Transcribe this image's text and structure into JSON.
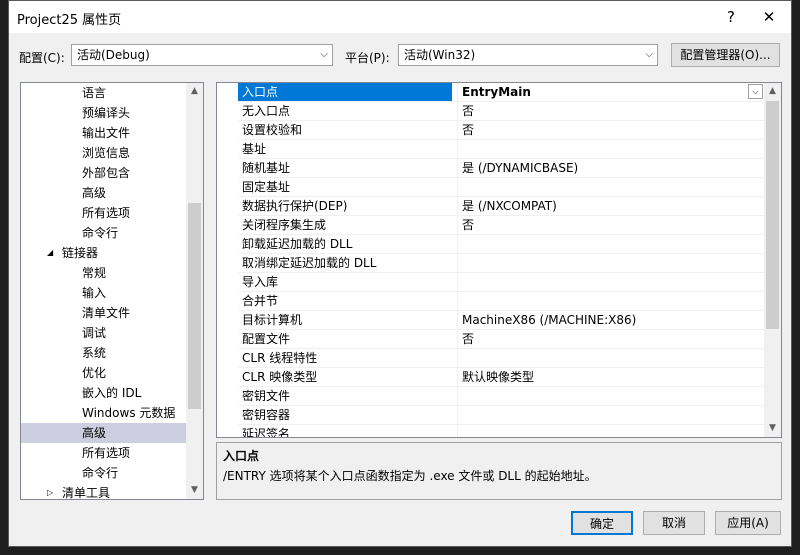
{
  "window": {
    "title": "Project25 属性页"
  },
  "titlebar_buttons": {
    "help": "?",
    "close": "✕"
  },
  "config": {
    "config_label": "配置(C):",
    "config_value": "活动(Debug)",
    "platform_label": "平台(P):",
    "platform_value": "活动(Win32)",
    "manager_button": "配置管理器(O)..."
  },
  "tree": {
    "items": [
      {
        "label": "语言",
        "level": 2
      },
      {
        "label": "预编译头",
        "level": 2
      },
      {
        "label": "输出文件",
        "level": 2
      },
      {
        "label": "浏览信息",
        "level": 2
      },
      {
        "label": "外部包含",
        "level": 2
      },
      {
        "label": "高级",
        "level": 2
      },
      {
        "label": "所有选项",
        "level": 2
      },
      {
        "label": "命令行",
        "level": 2
      },
      {
        "label": "链接器",
        "level": 1,
        "expander": "◢"
      },
      {
        "label": "常规",
        "level": 2
      },
      {
        "label": "输入",
        "level": 2
      },
      {
        "label": "清单文件",
        "level": 2
      },
      {
        "label": "调试",
        "level": 2
      },
      {
        "label": "系统",
        "level": 2
      },
      {
        "label": "优化",
        "level": 2
      },
      {
        "label": "嵌入的 IDL",
        "level": 2
      },
      {
        "label": "Windows 元数据",
        "level": 2
      },
      {
        "label": "高级",
        "level": 2,
        "selected": true
      },
      {
        "label": "所有选项",
        "level": 2
      },
      {
        "label": "命令行",
        "level": 2
      },
      {
        "label": "清单工具",
        "level": 1,
        "expander": "▷"
      }
    ]
  },
  "properties": [
    {
      "name": "入口点",
      "value": "EntryMain",
      "selected": true
    },
    {
      "name": "无入口点",
      "value": "否"
    },
    {
      "name": "设置校验和",
      "value": "否"
    },
    {
      "name": "基址",
      "value": ""
    },
    {
      "name": "随机基址",
      "value": "是 (/DYNAMICBASE)"
    },
    {
      "name": "固定基址",
      "value": ""
    },
    {
      "name": "数据执行保护(DEP)",
      "value": "是 (/NXCOMPAT)"
    },
    {
      "name": "关闭程序集生成",
      "value": "否"
    },
    {
      "name": "卸载延迟加载的 DLL",
      "value": ""
    },
    {
      "name": "取消绑定延迟加载的 DLL",
      "value": ""
    },
    {
      "name": "导入库",
      "value": ""
    },
    {
      "name": "合并节",
      "value": ""
    },
    {
      "name": "目标计算机",
      "value": "MachineX86 (/MACHINE:X86)"
    },
    {
      "name": "配置文件",
      "value": "否"
    },
    {
      "name": "CLR 线程特性",
      "value": ""
    },
    {
      "name": "CLR 映像类型",
      "value": "默认映像类型"
    },
    {
      "name": "密钥文件",
      "value": ""
    },
    {
      "name": "密钥容器",
      "value": ""
    },
    {
      "name": "延迟签名",
      "value": ""
    }
  ],
  "description": {
    "title": "入口点",
    "text": "/ENTRY 选项将某个入口点函数指定为 .exe 文件或 DLL 的起始地址。"
  },
  "buttons": {
    "ok": "确定",
    "cancel": "取消",
    "apply": "应用(A)"
  },
  "colors": {
    "selection": "#0078d7",
    "tree_selection": "#cdcde0",
    "dialog_bg": "#f0f0f0"
  }
}
